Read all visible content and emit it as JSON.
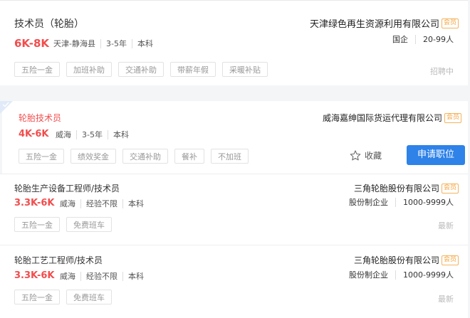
{
  "jobs": [
    {
      "title": "技术员（轮胎）",
      "salary": "6K-8K",
      "meta": [
        "天津-静海县",
        "3-5年",
        "本科"
      ],
      "tags": [
        "五险一金",
        "加班补助",
        "交通补助",
        "带薪年假",
        "采暖补贴"
      ],
      "company": "天津绿色再生资源利用有限公司",
      "vip": "会员",
      "company_meta": [
        "国企",
        "20-99人"
      ],
      "status": "招聘中"
    },
    {
      "title": "轮胎技术员",
      "salary": "4K-6K",
      "meta": [
        "威海",
        "3-5年",
        "本科"
      ],
      "tags": [
        "五险一金",
        "绩效奖金",
        "交通补助",
        "餐补",
        "不加班"
      ],
      "company": "威海嘉绅国际货运代理有限公司",
      "vip": "会员",
      "favorite_label": "收藏",
      "apply_label": "申请职位"
    },
    {
      "title": "轮胎生产设备工程师/技术员",
      "salary": "3.3K-6K",
      "meta": [
        "威海",
        "经验不限",
        "本科"
      ],
      "tags": [
        "五险一金",
        "免费班车"
      ],
      "company": "三角轮胎股份有限公司",
      "vip": "会员",
      "company_meta": [
        "股份制企业",
        "1000-9999人"
      ],
      "status": "最新"
    },
    {
      "title": "轮胎工艺工程师/技术员",
      "salary": "3.3K-6K",
      "meta": [
        "威海",
        "经验不限",
        "本科"
      ],
      "tags": [
        "五险一金",
        "免费班车"
      ],
      "company": "三角轮胎股份有限公司",
      "vip": "会员",
      "company_meta": [
        "股份制企业",
        "1000-9999人"
      ],
      "status": "最新"
    }
  ],
  "colors": {
    "accent_red": "#f24d4d",
    "apply_blue": "#2e82e8",
    "vip_orange": "#f4a23a"
  }
}
